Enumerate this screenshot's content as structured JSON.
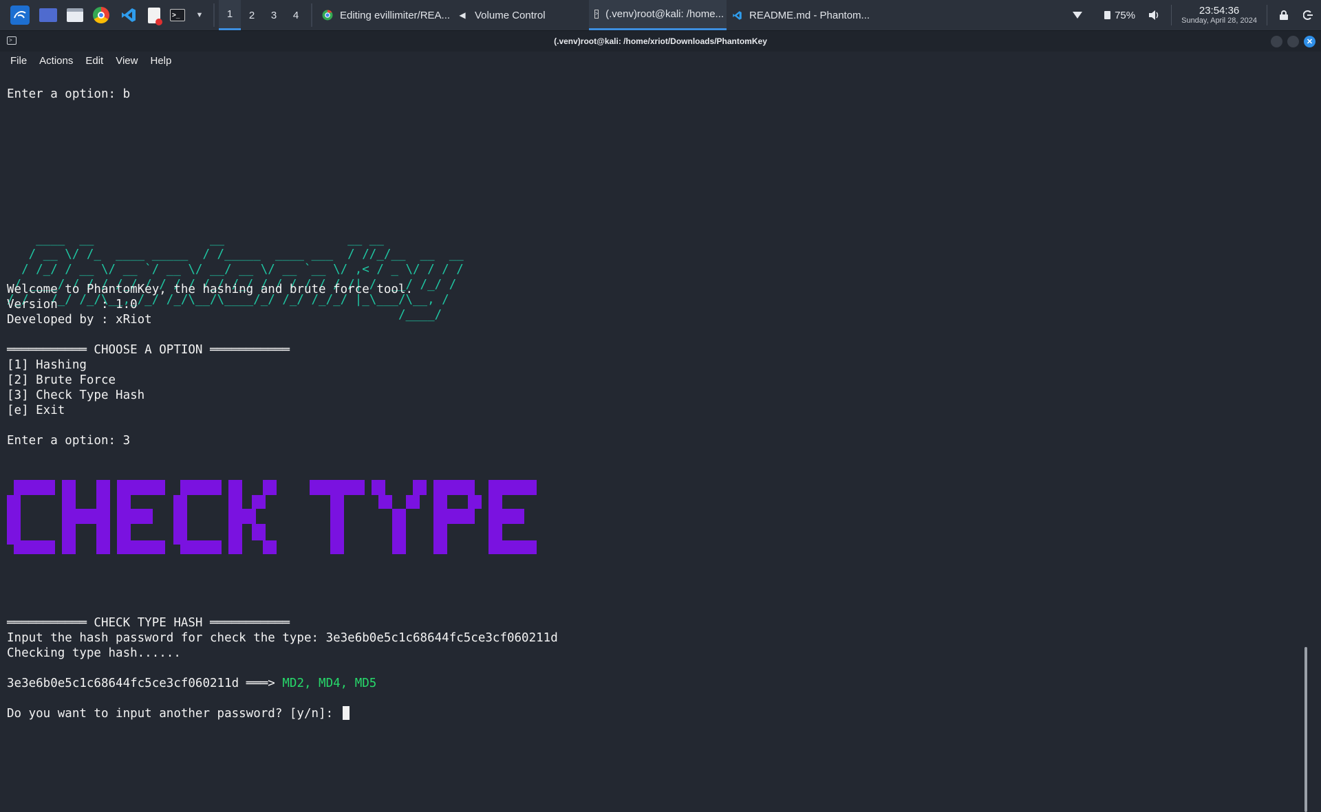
{
  "taskbar": {
    "workspaces": [
      "1",
      "2",
      "3",
      "4"
    ],
    "tasks": [
      {
        "label": "Editing evillimiter/REA..."
      },
      {
        "label": "Volume Control"
      },
      {
        "label": "(.venv)root@kali: /home..."
      },
      {
        "label": "README.md - Phantom..."
      }
    ],
    "battery": "75%",
    "time": "23:54:36",
    "date": "Sunday, April 28, 2024"
  },
  "window": {
    "title": "(.venv)root@kali: /home/xriot/Downloads/PhantomKey",
    "menu": [
      "File",
      "Actions",
      "Edit",
      "View",
      "Help"
    ]
  },
  "terminal": {
    "line_option_b": "Enter a option: b",
    "logo_text": "PhantomKey",
    "welcome": "Welcome to PhantomKey, the hashing and brute force tool.",
    "version": "Version      : 1.0",
    "developer": "Developed by : xRiot",
    "menu_header": "═══════════ CHOOSE A OPTION ═══════════",
    "options": [
      "[1] Hashing",
      "[2] Brute Force",
      "[3] Check Type Hash",
      "[e] Exit"
    ],
    "line_option_3": "Enter a option: 3",
    "banner_text": "CHECK TYPE",
    "section_header": "═══════════ CHECK TYPE HASH ═══════════",
    "input_prompt": "Input the hash password for check the type: 3e3e6b0e5c1c68644fc5ce3cf060211d",
    "checking": "Checking type hash......",
    "result_hash": "3e3e6b0e5c1c68644fc5ce3cf060211d ═══> ",
    "result_types": "MD2, MD4, MD5",
    "again_prompt": "Do you want to input another password? [y/n]: "
  },
  "colors": {
    "logo": "#1fc7a3",
    "banner": "#7a12e0",
    "result": "#27d86a"
  }
}
